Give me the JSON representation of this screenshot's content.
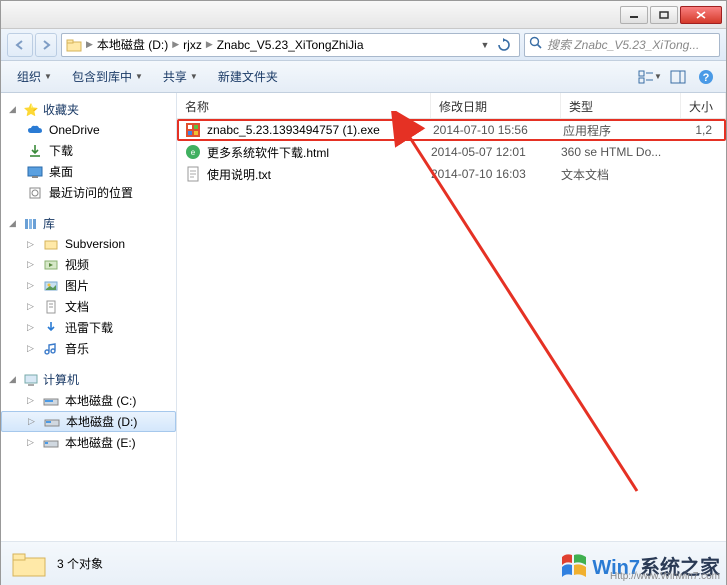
{
  "breadcrumb": {
    "seg1": "本地磁盘 (D:)",
    "seg2": "rjxz",
    "seg3": "Znabc_V5.23_XiTongZhiJia"
  },
  "search": {
    "placeholder": "搜索 Znabc_V5.23_XiTong..."
  },
  "toolbar": {
    "organize": "组织",
    "include": "包含到库中",
    "share": "共享",
    "newfolder": "新建文件夹"
  },
  "columns": {
    "name": "名称",
    "date": "修改日期",
    "type": "类型",
    "size": "大小"
  },
  "sidebar": {
    "fav": "收藏夹",
    "fav_items": [
      "OneDrive",
      "下载",
      "桌面",
      "最近访问的位置"
    ],
    "lib": "库",
    "lib_items": [
      "Subversion",
      "视频",
      "图片",
      "文档",
      "迅雷下载",
      "音乐"
    ],
    "computer": "计算机",
    "drives": [
      "本地磁盘 (C:)",
      "本地磁盘 (D:)",
      "本地磁盘 (E:)"
    ]
  },
  "files": [
    {
      "name": "znabc_5.23.1393494757 (1).exe",
      "date": "2014-07-10 15:56",
      "type": "应用程序",
      "size": "1,2"
    },
    {
      "name": "更多系统软件下载.html",
      "date": "2014-05-07 12:01",
      "type": "360 se HTML Do...",
      "size": ""
    },
    {
      "name": "使用说明.txt",
      "date": "2014-07-10 16:03",
      "type": "文本文档",
      "size": ""
    }
  ],
  "status": {
    "count": "3 个对象"
  },
  "watermark": {
    "brand1": "Win7",
    "brand2": "系统之家",
    "url": "Http://www.Winwin7.com"
  }
}
